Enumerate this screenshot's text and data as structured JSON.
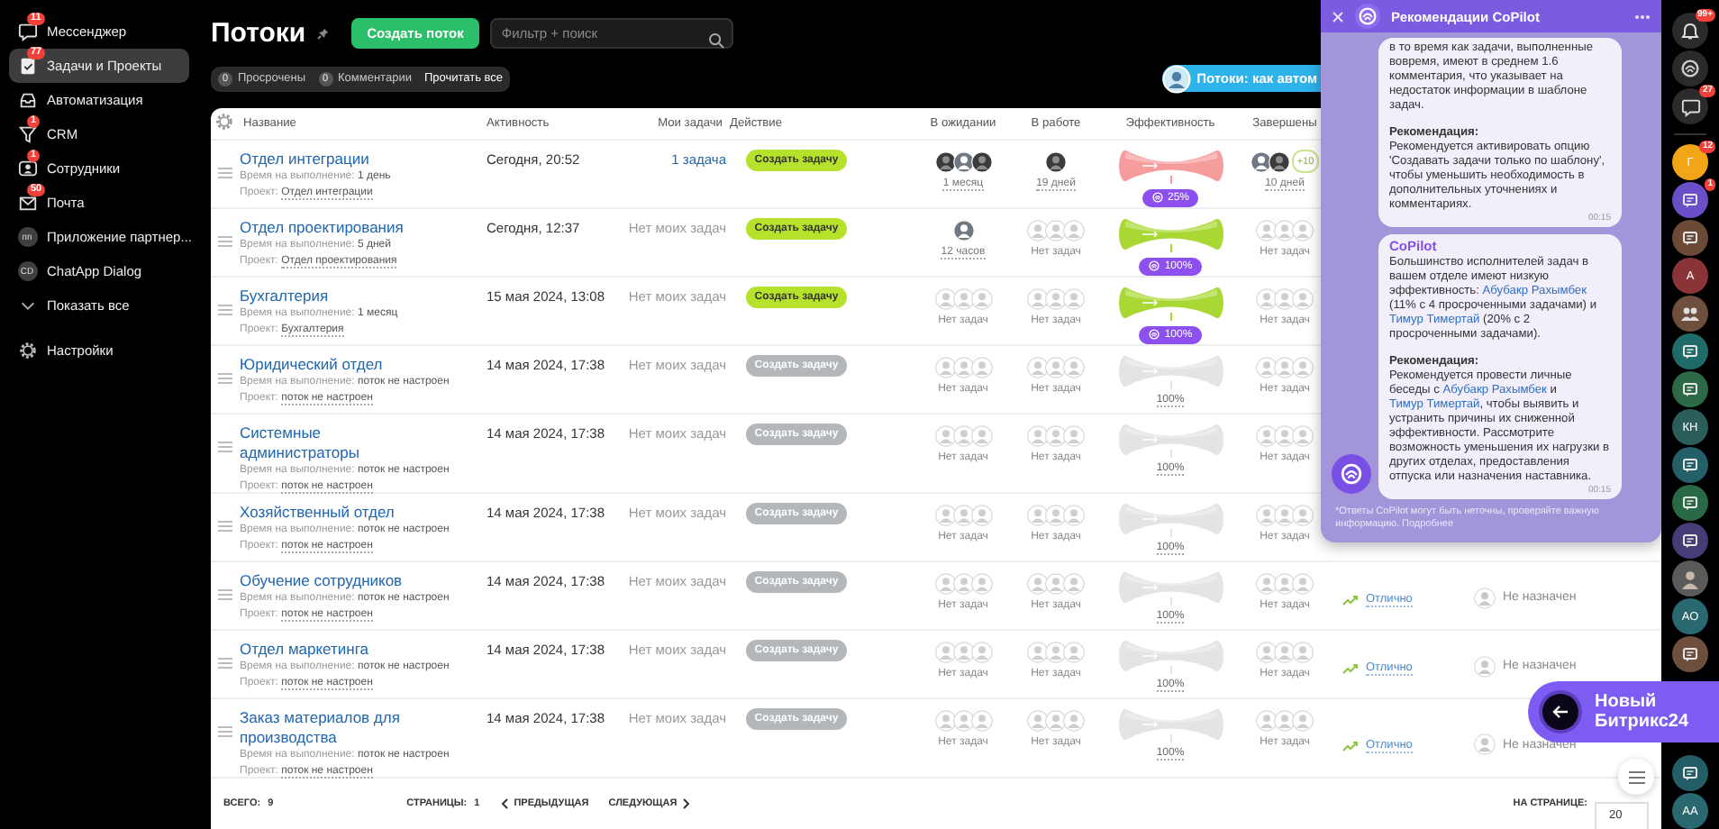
{
  "sidebar": {
    "items": [
      {
        "kind": "chat",
        "label": "Мессенджер",
        "badge": "11",
        "selected": false
      },
      {
        "kind": "tasks",
        "label": "Задачи и Проекты",
        "badge": "77",
        "selected": true
      },
      {
        "kind": "tray",
        "label": "Автоматизация",
        "selected": false
      },
      {
        "kind": "funnel",
        "label": "CRM",
        "badge": "1",
        "selected": false
      },
      {
        "kind": "people",
        "label": "Сотрудники",
        "badge": "1",
        "selected": false
      },
      {
        "kind": "mail",
        "label": "Почта",
        "badge": "50",
        "selected": false
      },
      {
        "kind": "initials",
        "initials": "пп",
        "label": "Приложение партнер...",
        "selected": false
      },
      {
        "kind": "initials",
        "initials": "CD",
        "label": "ChatApp Dialog",
        "selected": false
      },
      {
        "kind": "chevron",
        "label": "Показать все",
        "selected": false
      }
    ],
    "settings": "Настройки"
  },
  "header": {
    "title": "Потоки",
    "create_button": "Создать поток",
    "search": {
      "placeholder": "Фильтр + поиск"
    },
    "counters": [
      {
        "count": "0",
        "label": "Просрочены"
      },
      {
        "count": "0",
        "label": "Комментарии"
      }
    ],
    "read_all": "Прочитать все",
    "promo": "Потоки: как автом"
  },
  "table": {
    "columns": [
      "Название",
      "Активность",
      "Мои задачи",
      "Действие",
      "В ожидании",
      "В работе",
      "Эффективность",
      "Завершены"
    ],
    "rows": [
      {
        "name": "Отдел интеграции",
        "duration_label": "Время на выполнение:",
        "duration": "1 день",
        "project_label": "Проект:",
        "project": "Отдел интеграции",
        "activity": "Сегодня, 20:52",
        "my_tasks": {
          "kind": "link",
          "text": "1 задача"
        },
        "action": {
          "label": "Создать задачу",
          "active": true
        },
        "waiting": {
          "kind": "people",
          "avatars": [
            {
              "kind": "photo"
            },
            {
              "kind": "user"
            },
            {
              "kind": "photo"
            }
          ],
          "label": "1 месяц"
        },
        "in_work": {
          "kind": "people",
          "avatars": [
            {
              "kind": "photo"
            }
          ],
          "label": "19 дней"
        },
        "efficiency": {
          "color": "#f59c9c",
          "badge": true,
          "label": "25%"
        },
        "completed": {
          "kind": "people",
          "avatars": [
            {
              "kind": "user"
            },
            {
              "kind": "photo"
            }
          ],
          "more": "+10",
          "label": "10 дней"
        }
      },
      {
        "name": "Отдел проектирования",
        "duration_label": "Время на выполнение:",
        "duration": "5 дней",
        "project_label": "Проект:",
        "project": "Отдел проектирования",
        "activity": "Сегодня, 12:37",
        "my_tasks": {
          "kind": "text",
          "text": "Нет моих задач"
        },
        "action": {
          "label": "Создать задачу",
          "active": true
        },
        "waiting": {
          "kind": "people",
          "avatars": [
            {
              "kind": "user"
            }
          ],
          "label": "12 часов"
        },
        "in_work": {
          "kind": "empty",
          "label": "Нет задач"
        },
        "efficiency": {
          "color": "#a9d834",
          "badge": true,
          "label": "100%"
        },
        "completed": {
          "kind": "empty",
          "label": "Нет задач"
        }
      },
      {
        "name": "Бухгалтерия",
        "duration_label": "Время на выполнение:",
        "duration": "1 месяц",
        "project_label": "Проект:",
        "project": "Бухгалтерия",
        "activity": "15 мая 2024, 13:08",
        "my_tasks": {
          "kind": "text",
          "text": "Нет моих задач"
        },
        "action": {
          "label": "Создать задачу",
          "active": true
        },
        "waiting": {
          "kind": "empty",
          "label": "Нет задач"
        },
        "in_work": {
          "kind": "empty",
          "label": "Нет задач"
        },
        "efficiency": {
          "color": "#a9d834",
          "badge": true,
          "label": "100%"
        },
        "completed": {
          "kind": "empty",
          "label": "Нет задач"
        }
      },
      {
        "name": "Юридический отдел",
        "duration_label": "Время на выполнение:",
        "duration": "поток не настроен",
        "project_label": "Проект:",
        "project": "поток не настроен",
        "activity": "14 мая 2024, 17:38",
        "my_tasks": {
          "kind": "text",
          "text": "Нет моих задач"
        },
        "action": {
          "label": "Создать задачу",
          "active": false
        },
        "waiting": {
          "kind": "empty",
          "label": "Нет задач"
        },
        "in_work": {
          "kind": "empty",
          "label": "Нет задач"
        },
        "efficiency": {
          "color": "#e4e4e6",
          "badge": false,
          "label": "100%"
        },
        "completed": {
          "kind": "empty",
          "label": "Нет задач"
        }
      },
      {
        "name": "Системные администраторы",
        "duration_label": "Время на выполнение:",
        "duration": "поток не настроен",
        "project_label": "Проект:",
        "project": "поток не настроен",
        "activity": "14 мая 2024, 17:38",
        "my_tasks": {
          "kind": "text",
          "text": "Нет моих задач"
        },
        "action": {
          "label": "Создать задачу",
          "active": false
        },
        "waiting": {
          "kind": "empty",
          "label": "Нет задач"
        },
        "in_work": {
          "kind": "empty",
          "label": "Нет задач"
        },
        "efficiency": {
          "color": "#e4e4e6",
          "badge": false,
          "label": "100%"
        },
        "completed": {
          "kind": "empty",
          "label": "Нет задач"
        }
      },
      {
        "name": "Хозяйственный отдел",
        "duration_label": "Время на выполнение:",
        "duration": "поток не настроен",
        "project_label": "Проект:",
        "project": "поток не настроен",
        "activity": "14 мая 2024, 17:38",
        "my_tasks": {
          "kind": "text",
          "text": "Нет моих задач"
        },
        "action": {
          "label": "Создать задачу",
          "active": false
        },
        "waiting": {
          "kind": "empty",
          "label": "Нет задач"
        },
        "in_work": {
          "kind": "empty",
          "label": "Нет задач"
        },
        "efficiency": {
          "color": "#e4e4e6",
          "badge": false,
          "label": "100%"
        },
        "completed": {
          "kind": "empty",
          "label": "Нет задач"
        }
      },
      {
        "name": "Обучение сотрудников",
        "duration_label": "Время на выполнение:",
        "duration": "поток не настроен",
        "project_label": "Проект:",
        "project": "поток не настроен",
        "activity": "14 мая 2024, 17:38",
        "my_tasks": {
          "kind": "text",
          "text": "Нет моих задач"
        },
        "action": {
          "label": "Создать задачу",
          "active": false
        },
        "waiting": {
          "kind": "empty",
          "label": "Нет задач"
        },
        "in_work": {
          "kind": "empty",
          "label": "Нет задач"
        },
        "efficiency": {
          "color": "#e4e4e6",
          "badge": false,
          "label": "100%"
        },
        "completed": {
          "kind": "empty",
          "label": "Нет задач"
        },
        "column_10": "Отлично",
        "column_11": "Не назначен"
      },
      {
        "name": "Отдел маркетинга",
        "duration_label": "Время на выполнение:",
        "duration": "поток не настроен",
        "project_label": "Проект:",
        "project": "поток не настроен",
        "activity": "14 мая 2024, 17:38",
        "my_tasks": {
          "kind": "text",
          "text": "Нет моих задач"
        },
        "action": {
          "label": "Создать задачу",
          "active": false
        },
        "waiting": {
          "kind": "empty",
          "label": "Нет задач"
        },
        "in_work": {
          "kind": "empty",
          "label": "Нет задач"
        },
        "efficiency": {
          "color": "#e4e4e6",
          "badge": false,
          "label": "100%"
        },
        "completed": {
          "kind": "empty",
          "label": "Нет задач"
        },
        "column_10": "Отлично",
        "column_11": "Не назначен"
      },
      {
        "name": "Заказ материалов для производства",
        "duration_label": "Время на выполнение:",
        "duration": "поток не настроен",
        "project_label": "Проект:",
        "project": "поток не настроен",
        "activity": "14 мая 2024, 17:38",
        "my_tasks": {
          "kind": "text",
          "text": "Нет моих задач"
        },
        "action": {
          "label": "Создать задачу",
          "active": false
        },
        "waiting": {
          "kind": "empty",
          "label": "Нет задач"
        },
        "in_work": {
          "kind": "empty",
          "label": "Нет задач"
        },
        "efficiency": {
          "color": "#e4e4e6",
          "badge": false,
          "label": "100%"
        },
        "completed": {
          "kind": "empty",
          "label": "Нет задач"
        },
        "column_10": "Отлично",
        "column_11": "Не назначен"
      }
    ],
    "footer": {
      "total_label": "ВСЕГО:",
      "total": "9",
      "pages_label": "СТРАНИЦЫ:",
      "page": "1",
      "prev": "ПРЕДЫДУЩАЯ",
      "next": "СЛЕДУЮЩАЯ",
      "per_page_label": "НА СТРАНИЦЕ:",
      "per_page": "20"
    }
  },
  "copilot": {
    "title": "Рекомендации CoPilot",
    "messages": [
      {
        "paragraphs": [
          {
            "parts": [
              {
                "kind": "text",
                "text": "в то время как задачи, выполненные вовремя, имеют в среднем 1.6 комментария, что указывает на недостаток информации в шаблоне задач."
              }
            ]
          },
          {
            "heading": "Рекомендация:",
            "parts": [
              {
                "kind": "text",
                "text": "Рекомендуется активировать опцию 'Создавать задачи только по шаблону', чтобы уменьшить необходимость в дополнительных уточнениях и комментариях."
              }
            ]
          }
        ],
        "time": "00:15"
      },
      {
        "author": "CoPilot",
        "paragraphs": [
          {
            "parts": [
              {
                "kind": "text",
                "text": "Большинство исполнителей задач в вашем отделе имеют низкую эффективность: "
              },
              {
                "kind": "link",
                "text": "Абубакр Рахымбек"
              },
              {
                "kind": "text",
                "text": " (11% с 4 просроченными задачами) и "
              },
              {
                "kind": "link",
                "text": "Тимур Тимертай"
              },
              {
                "kind": "text",
                "text": " (20% с 2 просроченными задачами)."
              }
            ]
          },
          {
            "heading": "Рекомендация:",
            "parts": [
              {
                "kind": "text",
                "text": "Рекомендуется провести личные беседы с "
              },
              {
                "kind": "link",
                "text": "Абубакр Рахымбек"
              },
              {
                "kind": "text",
                "text": " и "
              },
              {
                "kind": "link",
                "text": "Тимур Тимертай"
              },
              {
                "kind": "text",
                "text": ", чтобы выявить и устранить причины их сниженной эффективности. Рассмотрите возможность уменьшения их нагрузки в других отделах, предоставления отпуска или назначения наставника."
              }
            ]
          }
        ],
        "time": "00:15"
      }
    ],
    "disclaimer": "*Ответы CoPilot могут быть неточны, проверяйте важную информацию. ",
    "more_link": "Подробнее"
  },
  "right_bar": {
    "tools": [
      {
        "kind": "bell",
        "badge": "99+"
      },
      {
        "kind": "logo"
      },
      {
        "kind": "chat",
        "badge": "27"
      }
    ],
    "chats": [
      {
        "kind": "initials",
        "initials": "Г",
        "color": "#f2a516",
        "badge": "12"
      },
      {
        "kind": "chat",
        "color": "#6a4fc8",
        "badge": "1"
      },
      {
        "kind": "chat",
        "color": "#6b4a38"
      },
      {
        "kind": "initials",
        "initials": "А",
        "color": "#8a3438"
      },
      {
        "kind": "group",
        "color": "#6e4e3c"
      },
      {
        "kind": "chat",
        "color": "#1f6b69"
      },
      {
        "kind": "chat",
        "color": "#2c6a48"
      },
      {
        "kind": "initials",
        "initials": "КН",
        "color": "#2b5e5a"
      },
      {
        "kind": "chat",
        "color": "#245f68"
      },
      {
        "kind": "chat",
        "color": "#2a6945"
      },
      {
        "kind": "chat",
        "color": "#463c78"
      },
      {
        "kind": "photo",
        "color": "#5a5a5a"
      },
      {
        "kind": "initials",
        "initials": "АО",
        "color": "#2a6870"
      },
      {
        "kind": "chat",
        "color": "#6e4e3c"
      },
      {
        "kind": "chat",
        "color": "#235e66"
      },
      {
        "kind": "initials",
        "initials": "АА",
        "color": "#2a6870"
      }
    ]
  },
  "new_ui": {
    "label": "Новый Битрикс24"
  }
}
